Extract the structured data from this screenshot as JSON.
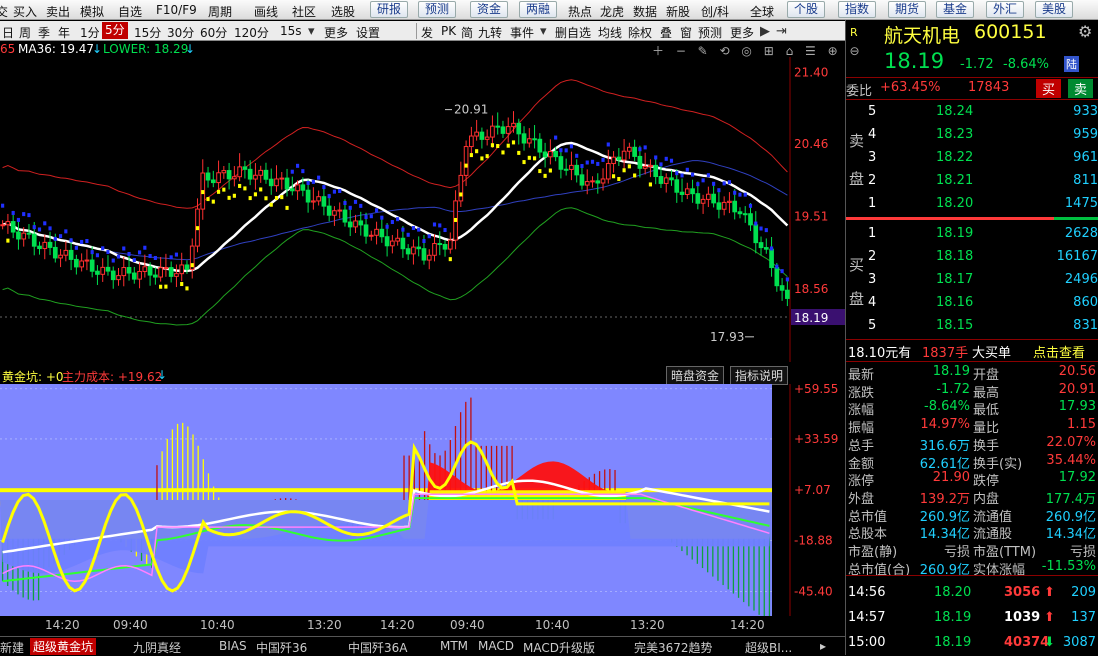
{
  "menubar": {
    "left": [
      "交",
      "买入",
      "卖出",
      "模拟",
      "自选",
      "F10/F9",
      "周期",
      "画线",
      "社区",
      "选股"
    ],
    "buttons": [
      "研报",
      "预测",
      "资金",
      "两融",
      "热点",
      "龙虎",
      "数据",
      "新股",
      "创/科",
      "全球",
      "个股",
      "指数",
      "期货",
      "基金",
      "外汇",
      "美股"
    ]
  },
  "toolbar": {
    "periods": [
      "日",
      "周",
      "季",
      "年",
      "1分",
      "5分",
      "15分",
      "30分",
      "60分",
      "120分",
      "15s"
    ],
    "selected_period": "5分",
    "items": [
      "更多",
      "设置",
      "发",
      "PK",
      "简",
      "九转",
      "事件",
      "删自选",
      "均线",
      "除权",
      "叠",
      "窗",
      "预测",
      "更多"
    ]
  },
  "legend": {
    "ma65_label": "65",
    "ma36_label": "MA36: 19.47",
    "lower_label": "LOWER: 18.29"
  },
  "price_axis": [
    "21.40",
    "20.46",
    "19.51",
    "18.56",
    "18.19"
  ],
  "annotations": {
    "high": "20.91",
    "low": "17.93"
  },
  "indicator": {
    "name": "黄金坑: +0",
    "cost_label": "主力成本: +19.62",
    "btn1": "暗盘资金",
    "btn2": "指标说明",
    "axis": [
      "+59.55",
      "+33.59",
      "+7.07",
      "-18.88",
      "-45.40"
    ]
  },
  "time_axis": [
    "14:20",
    "09:40",
    "10:40",
    "13:20",
    "14:20",
    "09:40",
    "10:40",
    "13:20",
    "14:20"
  ],
  "tabs": [
    "新建",
    "超级黄金坑",
    "九阴真经",
    "BIAS",
    "中国歼36",
    "中国歼36A",
    "MTM",
    "MACD",
    "MACD升级版",
    "完美3672趋势",
    "超级BI..."
  ],
  "quote": {
    "tag": "R",
    "name": "航天机电",
    "code": "600151",
    "price": "18.19",
    "change": "-1.72",
    "pct": "-8.64%",
    "exchange": "陆",
    "weibi_label": "委比",
    "weibi": "+63.45%",
    "weicha": "17843",
    "buy_btn": "买",
    "sell_btn": "卖",
    "sell_label": [
      "卖",
      "盘"
    ],
    "buy_label": [
      "买",
      "盘"
    ],
    "asks": [
      {
        "n": "5",
        "p": "18.24",
        "v": "933"
      },
      {
        "n": "4",
        "p": "18.23",
        "v": "959"
      },
      {
        "n": "3",
        "p": "18.22",
        "v": "961"
      },
      {
        "n": "2",
        "p": "18.21",
        "v": "811"
      },
      {
        "n": "1",
        "p": "18.20",
        "v": "1475"
      }
    ],
    "bids": [
      {
        "n": "1",
        "p": "18.19",
        "v": "2628"
      },
      {
        "n": "2",
        "p": "18.18",
        "v": "16167"
      },
      {
        "n": "3",
        "p": "18.17",
        "v": "2496"
      },
      {
        "n": "4",
        "p": "18.16",
        "v": "860"
      },
      {
        "n": "5",
        "p": "18.15",
        "v": "831"
      }
    ],
    "banner": {
      "a": "18.10元有",
      "b": "1837手",
      "c": "大买单",
      "d": "点击查看"
    },
    "stats": [
      [
        "最新",
        "18.19",
        "开盘",
        "20.56"
      ],
      [
        "涨跌",
        "-1.72",
        "最高",
        "20.91"
      ],
      [
        "涨幅",
        "-8.64%",
        "最低",
        "17.93"
      ],
      [
        "振幅",
        "14.97%",
        "量比",
        "1.15"
      ],
      [
        "总手",
        "316.6万",
        "换手",
        "22.07%"
      ],
      [
        "金额",
        "62.61亿",
        "换手(实)",
        "35.44%"
      ],
      [
        "涨停",
        "21.90",
        "跌停",
        "17.92"
      ],
      [
        "外盘",
        "139.2万",
        "内盘",
        "177.4万"
      ],
      [
        "总市值",
        "260.9亿",
        "流通值",
        "260.9亿"
      ],
      [
        "总股本",
        "14.34亿",
        "流通股",
        "14.34亿"
      ],
      [
        "市盈(静)",
        "亏损",
        "市盈(TTM)",
        "亏损"
      ],
      [
        "总市值(合)",
        "260.9亿",
        "实体涨幅",
        "-11.53%"
      ]
    ],
    "ticks": [
      {
        "t": "14:56",
        "p": "18.20",
        "v": "3056",
        "d": "1",
        "n": "209"
      },
      {
        "t": "14:57",
        "p": "18.19",
        "v": "1039",
        "d": "1",
        "n": "137"
      },
      {
        "t": "15:00",
        "p": "18.19",
        "v": "40374",
        "d": "-1",
        "n": "3087"
      }
    ]
  },
  "colors": {
    "up": "#ff3a3a",
    "down": "#00e050",
    "accent": "#c00000"
  }
}
